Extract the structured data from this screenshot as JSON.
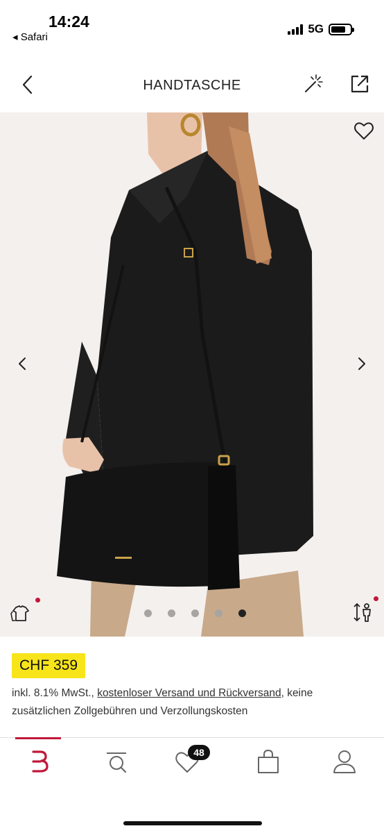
{
  "status_bar": {
    "time": "14:24",
    "back_app": "◂ Safari",
    "network": "5G",
    "signal_icon": "signal-bars-icon",
    "battery_icon": "battery-icon"
  },
  "header": {
    "title": "HANDTASCHE",
    "back_icon": "chevron-left-icon",
    "magic_icon": "magic-wand-icon",
    "share_icon": "share-external-icon"
  },
  "gallery": {
    "image_count": 5,
    "active_index": 4,
    "favorite_icon": "heart-outline-icon",
    "outfit_icon": "outfit-tshirt-icon",
    "size_icon": "size-fit-icon"
  },
  "product": {
    "price": "CHF 359",
    "tax_note_prefix": "inkl. 8.1% MwSt., ",
    "shipping_link": "kostenloser Versand und Rückversand",
    "tax_note_suffix": ", keine zusätzlichen Zollgebühren und Verzollungskosten"
  },
  "tabbar": {
    "items": [
      {
        "id": "brand",
        "icon": "brand-logo-icon"
      },
      {
        "id": "search",
        "icon": "search-icon"
      },
      {
        "id": "wishlist",
        "icon": "heart-icon"
      },
      {
        "id": "bag",
        "icon": "shopping-bag-icon"
      },
      {
        "id": "account",
        "icon": "user-icon"
      }
    ],
    "wishlist_count": "48"
  },
  "colors": {
    "accent": "#c0183a",
    "price_highlight": "#f7e51a",
    "background": "#f4f0ee"
  }
}
